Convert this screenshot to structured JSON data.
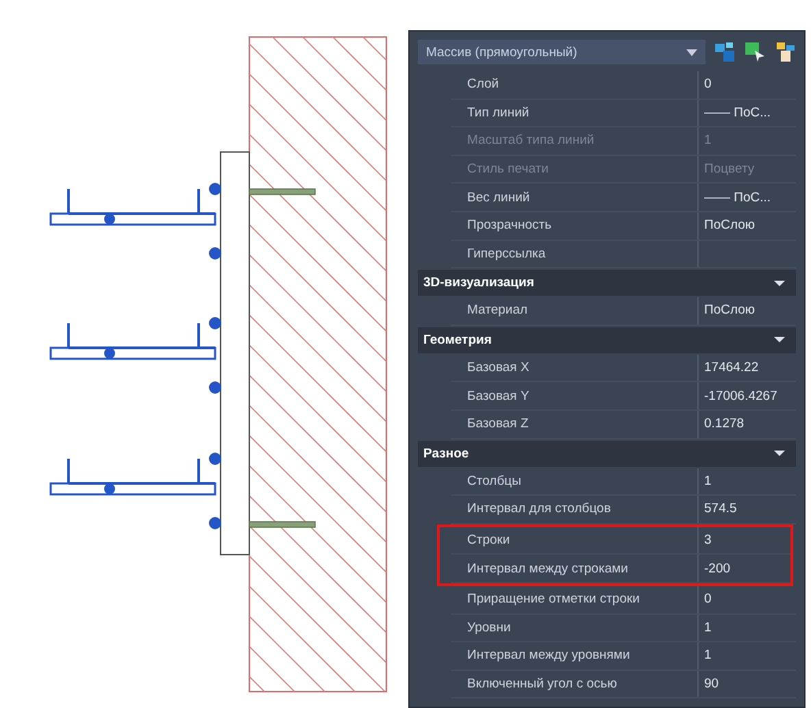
{
  "object_selector": {
    "value": "Массив (прямоугольный)"
  },
  "sections": [
    {
      "rows": [
        {
          "label": "Слой",
          "value": "0",
          "disabled": false,
          "highlighted": false
        },
        {
          "label": "Тип линий",
          "value": "—— ПоС...",
          "disabled": false,
          "highlighted": false
        },
        {
          "label": "Масштаб типа линий",
          "value": "1",
          "disabled": true,
          "highlighted": false
        },
        {
          "label": "Стиль печати",
          "value": "Поцвету",
          "disabled": true,
          "highlighted": false
        },
        {
          "label": "Вес линий",
          "value": "—— ПоС...",
          "disabled": false,
          "highlighted": false
        },
        {
          "label": "Прозрачность",
          "value": "ПоСлою",
          "disabled": false,
          "highlighted": false
        },
        {
          "label": "Гиперссылка",
          "disabled": false,
          "highlighted": false
        }
      ]
    },
    {
      "title": "3D-визуализация",
      "expanded": true,
      "rows": [
        {
          "label": "Материал",
          "value": "ПоСлою",
          "disabled": false,
          "highlighted": false
        }
      ]
    },
    {
      "title": "Геометрия",
      "expanded": true,
      "rows": [
        {
          "label": "Базовая X",
          "value": "17464.22",
          "disabled": false,
          "highlighted": false
        },
        {
          "label": "Базовая Y",
          "value": "-17006.4267",
          "disabled": false,
          "highlighted": false
        },
        {
          "label": "Базовая Z",
          "value": "0.1278",
          "disabled": false,
          "highlighted": false
        }
      ]
    },
    {
      "title": "Разное",
      "expanded": true,
      "rows": [
        {
          "label": "Столбцы",
          "value": "1",
          "disabled": false,
          "highlighted": false
        },
        {
          "label": "Интервал для столбцов",
          "value": "574.5",
          "disabled": false,
          "highlighted": false
        },
        {
          "label": "Строки",
          "value": "3",
          "disabled": false,
          "highlighted": true
        },
        {
          "label": "Интервал между строками",
          "value": "-200",
          "disabled": false,
          "highlighted": true
        },
        {
          "label": "Приращение отметки строки",
          "value": "0",
          "disabled": false,
          "highlighted": false
        },
        {
          "label": "Уровни",
          "value": "1",
          "disabled": false,
          "highlighted": false
        },
        {
          "label": "Интервал между уровнями",
          "value": "1",
          "disabled": false,
          "highlighted": false
        },
        {
          "label": "Включенный угол с осью",
          "value": "90",
          "disabled": false,
          "highlighted": false
        }
      ]
    }
  ]
}
